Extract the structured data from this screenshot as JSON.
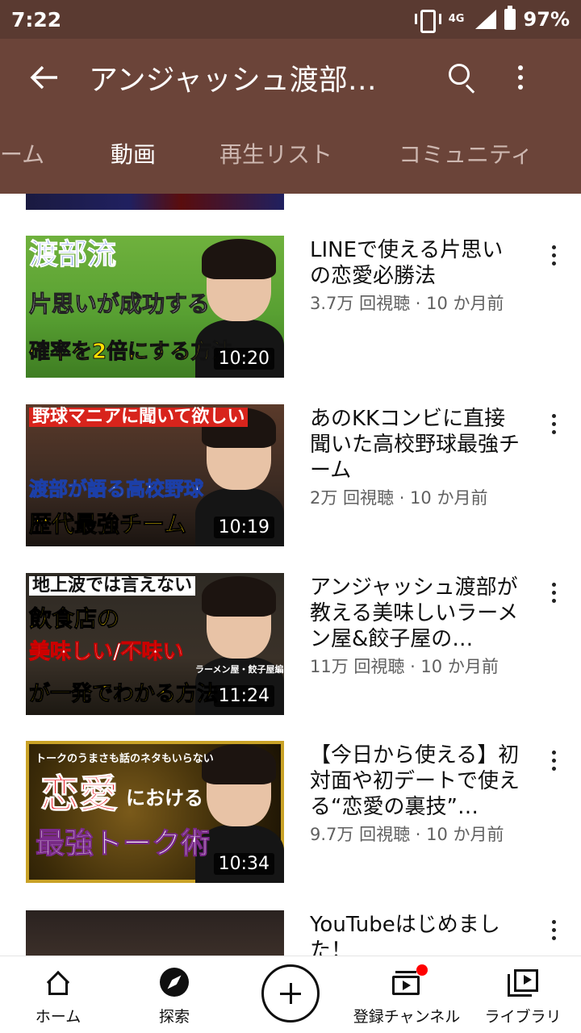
{
  "status_bar": {
    "time": "7:22",
    "network": "4G",
    "battery": "97%"
  },
  "app_bar": {
    "title": "アンジャッシュ渡部…"
  },
  "tabs": [
    "ーム",
    "動画",
    "再生リスト",
    "コミュニティ"
  ],
  "active_tab": "動画",
  "videos": [
    {
      "title": "LINEで使える片思いの恋愛必勝法",
      "meta": "3.7万 回視聴 · 10 か月前",
      "duration": "10:20",
      "thumb_captions": [
        "渡部流",
        "片思いが成功する",
        "確率を2倍にする方法"
      ]
    },
    {
      "title": "あのKKコンビに直接聞いた高校野球最強チーム",
      "meta": "2万 回視聴 · 10 か月前",
      "duration": "10:19",
      "thumb_captions": [
        "野球マニアに聞いて欲しい",
        "渡部が語る高校野球",
        "歴代最強チーム"
      ]
    },
    {
      "title": "アンジャッシュ渡部が教える美味しいラーメン屋&餃子屋の…",
      "meta": "11万 回視聴 · 10 か月前",
      "duration": "11:24",
      "thumb_captions": [
        "地上波では言えない",
        "飲食店の",
        "美味しい/不味い",
        "が一発でわかる方法",
        "ラーメン屋・餃子屋編"
      ]
    },
    {
      "title": "【今日から使える】初対面や初デートで使える“恋愛の裏技”…",
      "meta": "9.7万 回視聴 · 10 か月前",
      "duration": "10:34",
      "thumb_captions": [
        "トークのうまさも話のネタもいらない",
        "恋愛",
        "における",
        "最強トーク術"
      ]
    },
    {
      "title": "YouTubeはじめました！",
      "meta": "",
      "duration": "",
      "thumb_captions": []
    }
  ],
  "bottom_nav": {
    "home": "ホーム",
    "explore": "探索",
    "subscriptions": "登録チャンネル",
    "library": "ライブラリ"
  },
  "colors": {
    "app_bar": "#6b4439",
    "status_bar": "#5a3a31",
    "badge": "#ff0000"
  }
}
